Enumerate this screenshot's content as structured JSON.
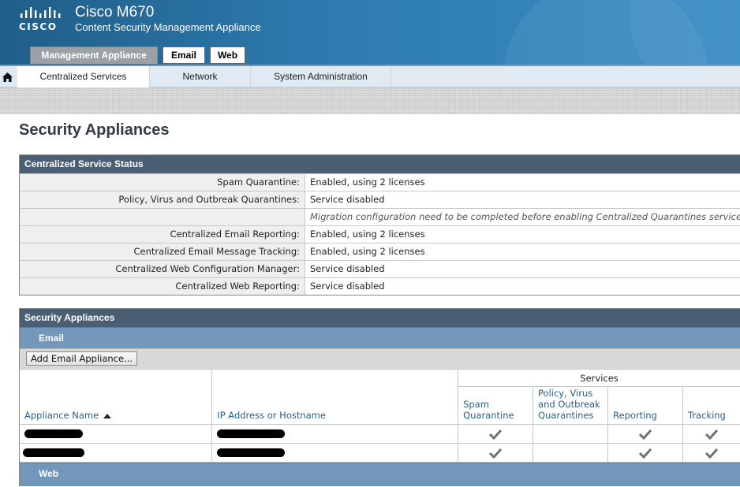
{
  "app": {
    "logo_text": "CISCO",
    "product": "Cisco M670",
    "subtitle": "Content Security Management Appliance"
  },
  "top_tabs": [
    {
      "label": "Management Appliance",
      "active": true
    },
    {
      "label": "Email",
      "active": false
    },
    {
      "label": "Web",
      "active": false
    }
  ],
  "nav": {
    "home_icon": "home-icon",
    "items": [
      {
        "label": "Centralized Services",
        "active": true
      },
      {
        "label": "Network",
        "active": false
      },
      {
        "label": "System Administration",
        "active": false
      }
    ]
  },
  "page_title": "Security Appliances",
  "status_panel": {
    "title": "Centralized Service Status",
    "rows": [
      {
        "label": "Spam Quarantine:",
        "value": "Enabled, using 2 licenses"
      },
      {
        "label": "Policy, Virus and Outbreak Quarantines:",
        "value": "Service disabled"
      },
      {
        "label": "",
        "value": "Migration configuration need to be completed before enabling Centralized Quarantines service f"
      },
      {
        "label": "Centralized Email Reporting:",
        "value": "Enabled, using 2 licenses"
      },
      {
        "label": "Centralized Email Message Tracking:",
        "value": "Enabled, using 2 licenses"
      },
      {
        "label": "Centralized Web Configuration Manager:",
        "value": "Service disabled"
      },
      {
        "label": "Centralized Web Reporting:",
        "value": "Service disabled"
      }
    ]
  },
  "appliances_panel": {
    "title": "Security Appliances",
    "email_section": "Email",
    "add_button": "Add Email Appliance...",
    "columns": {
      "name": "Appliance Name",
      "ip": "IP Address or Hostname",
      "services": "Services",
      "spam": "Spam Quarantine",
      "pvo": "Policy, Virus and Outbreak Quarantines",
      "reporting": "Reporting",
      "tracking": "Tracking"
    },
    "rows": [
      {
        "spam": true,
        "pvo": false,
        "reporting": true,
        "tracking": true
      },
      {
        "spam": true,
        "pvo": false,
        "reporting": true,
        "tracking": true
      }
    ],
    "web_section": "Web"
  },
  "colors": {
    "header_blue": "#2e7bb0",
    "panel_header": "#4a5f74",
    "section_header": "#7396bb",
    "link_blue": "#2a5e8c"
  }
}
